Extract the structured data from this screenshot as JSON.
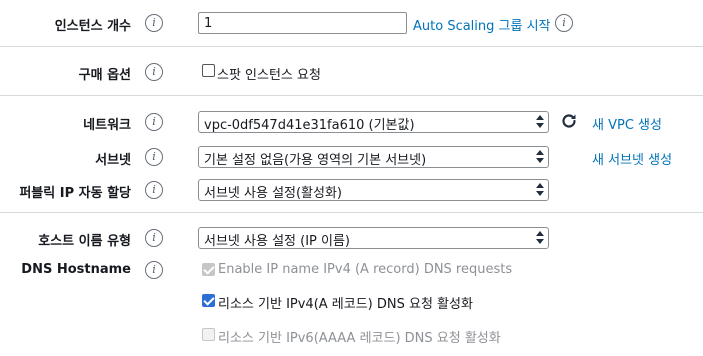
{
  "instances": {
    "label": "인스턴스 개수",
    "value": "1",
    "autoscaling_link": "Auto Scaling 그룹 시작"
  },
  "purchase": {
    "label": "구매 옵션",
    "spot_checkbox": {
      "label": "스팟 인스턴스 요청",
      "checked": false
    }
  },
  "network": {
    "label": "네트워크",
    "selected": "vpc-0df547d41e31fa610 (기본값)",
    "new_vpc_link": "새 VPC 생성"
  },
  "subnet": {
    "label": "서브넷",
    "selected": "기본 설정 없음(가용 영역의 기본 서브넷)",
    "new_subnet_link": "새 서브넷 생성"
  },
  "public_ip": {
    "label": "퍼블릭 IP 자동 할당",
    "selected": "서브넷 사용 설정(활성화)"
  },
  "hostname_type": {
    "label": "호스트 이름 유형",
    "selected": "서브넷 사용 설정 (IP 이름)"
  },
  "dns_hostname": {
    "label": "DNS Hostname",
    "options": [
      {
        "label": "Enable IP name IPv4 (A record) DNS requests",
        "checked": true,
        "disabled": true
      },
      {
        "label": "리소스 기반 IPv4(A 레코드) DNS 요청 활성화",
        "checked": true,
        "disabled": false
      },
      {
        "label": "리소스 기반 IPv6(AAAA 레코드) DNS 요청 활성화",
        "checked": false,
        "disabled": true
      }
    ]
  },
  "info_icon_glyph": "i",
  "colors": {
    "link": "#0073bb",
    "divider": "#d5dbdb",
    "checkbox_checked": "#2b6fd6"
  }
}
